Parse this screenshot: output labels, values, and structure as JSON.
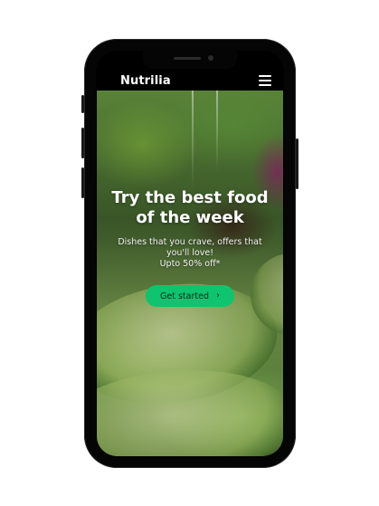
{
  "app": {
    "brand": "Nutrilia"
  },
  "hero": {
    "title": "Try the best food of the week",
    "subtitle_line1": "Dishes that you crave, offers that you'll love!",
    "subtitle_line2": "Upto 50% off*",
    "cta_label": "Get started",
    "cta_icon": "chevron-right-icon",
    "cta_color": "#0fc46e"
  },
  "header": {
    "menu_icon": "hamburger-menu-icon"
  }
}
